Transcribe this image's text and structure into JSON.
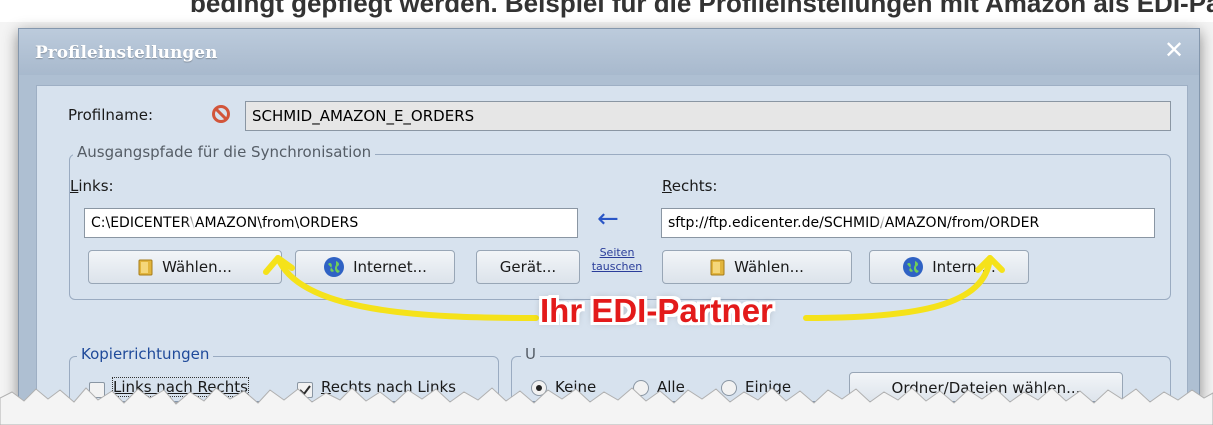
{
  "caption_above": "bedingt gepflegt werden. Beispiel für die Profileinstellungen mit Amazon als EDI-Partner:",
  "dialog": {
    "title": "Profileinstellungen",
    "close_glyph": "✕"
  },
  "profile": {
    "label": "Profilname:",
    "value": "SCHMID_AMAZON_E_ORDERS"
  },
  "paths_group": {
    "legend": "Ausgangspfade für die Synchronisation",
    "left_label_u": "L",
    "left_label_rest": "inks:",
    "right_label_u": "R",
    "right_label_rest": "echts:",
    "left_path_prefix": "C:\\EDICENTER\\",
    "left_path_highlight": "AMAZON\\from\\ORDERS",
    "right_path_prefix": "sftp://ftp.edicenter.de/SCHMID/",
    "right_path_highlight": "AMAZON/",
    "right_path_suffix": "from/ORDER",
    "arrow": "←",
    "swap_line1": "Seiten",
    "swap_line2": "tauschen",
    "left_choose": "Wählen...",
    "left_internet": "Internet...",
    "left_device": "Gerät...",
    "right_choose": "Wählen...",
    "right_internet": "Intern...."
  },
  "copy_group": {
    "legend": "Kopierrichtungen",
    "left_to_right": "Links nach Rechts",
    "left_to_right_checked": false,
    "right_to_left_u": "R",
    "right_to_left_rest": "echts nach Links",
    "right_to_left_checked": true
  },
  "selection_group": {
    "legend_visible": "U",
    "opt_none": "Keine",
    "opt_all": "Alle",
    "opt_some": "Einige",
    "selected": "Keine",
    "choose_files": "Ordner/Dateien wählen..."
  },
  "annotation": {
    "text": "Ihr EDI-Partner",
    "text_color": "#e31a1a",
    "arrow_color": "#f5e21a"
  },
  "colors": {
    "dialog_bg": "#aebfd2",
    "panel_bg": "#d7e2ee",
    "forbidden": "#d2553a"
  }
}
